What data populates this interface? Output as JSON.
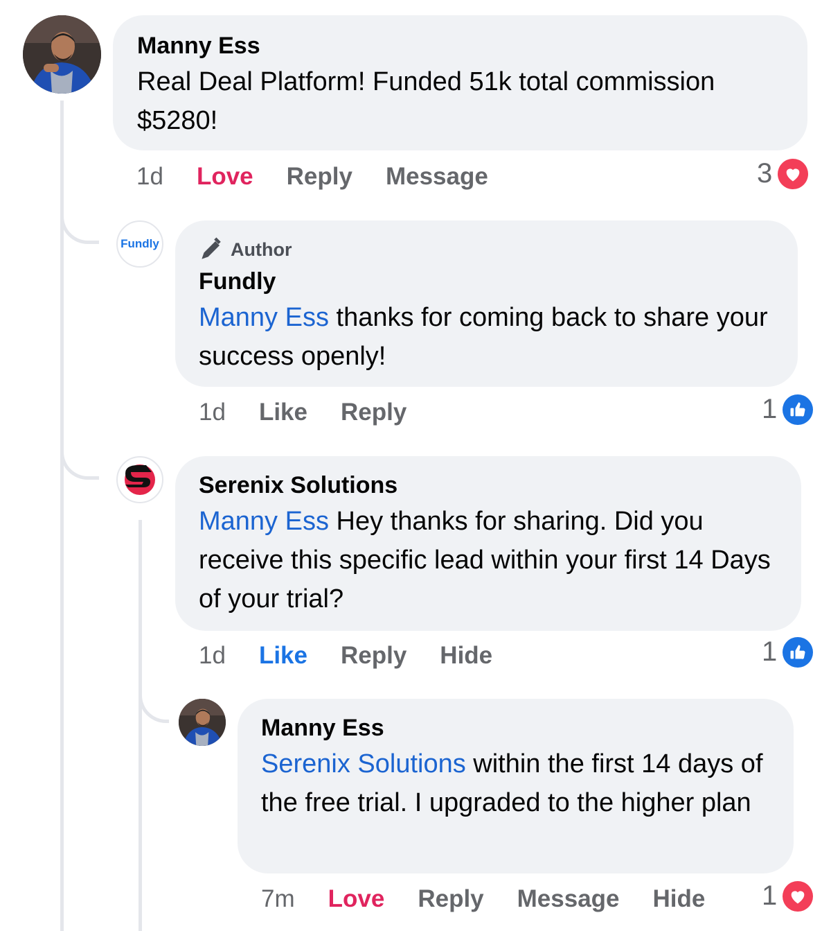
{
  "comments": [
    {
      "name": "Manny Ess",
      "text": "Real Deal Platform! Funded 51k total commission $5280!",
      "time": "1d",
      "actions": [
        "Love",
        "Reply",
        "Message"
      ],
      "reaction_count": "3",
      "reaction_icon": "heart-icon"
    },
    {
      "badge": "Author",
      "name": "Fundly",
      "avatar_text": "Fundly",
      "mention": "Manny Ess",
      "text": " thanks for coming back to share your success openly!",
      "time": "1d",
      "actions": [
        "Like",
        "Reply"
      ],
      "reaction_count": "1",
      "reaction_icon": "thumbs-up-icon"
    },
    {
      "name": "Serenix Solutions",
      "mention": "Manny Ess",
      "text": " Hey thanks for sharing. Did you receive this specific lead within your first 14 Days of your trial?",
      "time": "1d",
      "actions": [
        "Like",
        "Reply",
        "Hide"
      ],
      "reaction_count": "1",
      "reaction_icon": "thumbs-up-icon"
    },
    {
      "name": "Manny Ess",
      "mention": "Serenix Solutions",
      "text": " within the first 14 days of the free trial. I upgraded to the higher plan",
      "time": "7m",
      "actions": [
        "Love",
        "Reply",
        "Message",
        "Hide"
      ],
      "reaction_count": "1",
      "reaction_icon": "heart-icon"
    }
  ],
  "colors": {
    "mention": "#1b64d1",
    "love": "#e0245e",
    "like": "#1b74e4",
    "bubble": "#f0f2f5"
  }
}
